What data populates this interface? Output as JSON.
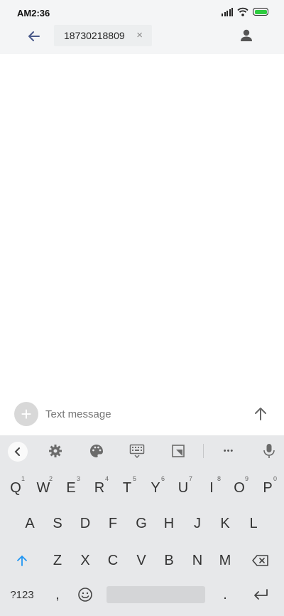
{
  "status_bar": {
    "time": "AM2:36",
    "battery_color": "#2ecc40"
  },
  "header": {
    "recipient": "18730218809",
    "remove_glyph": "×",
    "back_icon": "arrow-left-icon",
    "contact_icon": "person-icon"
  },
  "compose": {
    "add_glyph": "+",
    "placeholder": "Text message",
    "send_icon": "arrow-up-icon"
  },
  "keyboard": {
    "toolbar": [
      "chevron-left-icon",
      "gear-icon",
      "palette-icon",
      "keyboard-icon",
      "resize-icon",
      "more-icon",
      "microphone-icon"
    ],
    "more_glyph": "•••",
    "row1": [
      {
        "key": "Q",
        "hint": "1"
      },
      {
        "key": "W",
        "hint": "2"
      },
      {
        "key": "E",
        "hint": "3"
      },
      {
        "key": "R",
        "hint": "4"
      },
      {
        "key": "T",
        "hint": "5"
      },
      {
        "key": "Y",
        "hint": "6"
      },
      {
        "key": "U",
        "hint": "7"
      },
      {
        "key": "I",
        "hint": "8"
      },
      {
        "key": "O",
        "hint": "9"
      },
      {
        "key": "P",
        "hint": "0"
      }
    ],
    "row2": [
      "A",
      "S",
      "D",
      "F",
      "G",
      "H",
      "J",
      "K",
      "L"
    ],
    "row3": [
      "Z",
      "X",
      "C",
      "V",
      "B",
      "N",
      "M"
    ],
    "symbols_label": "?123",
    "comma": ",",
    "period": ".",
    "shift_color": "#2196f3"
  }
}
